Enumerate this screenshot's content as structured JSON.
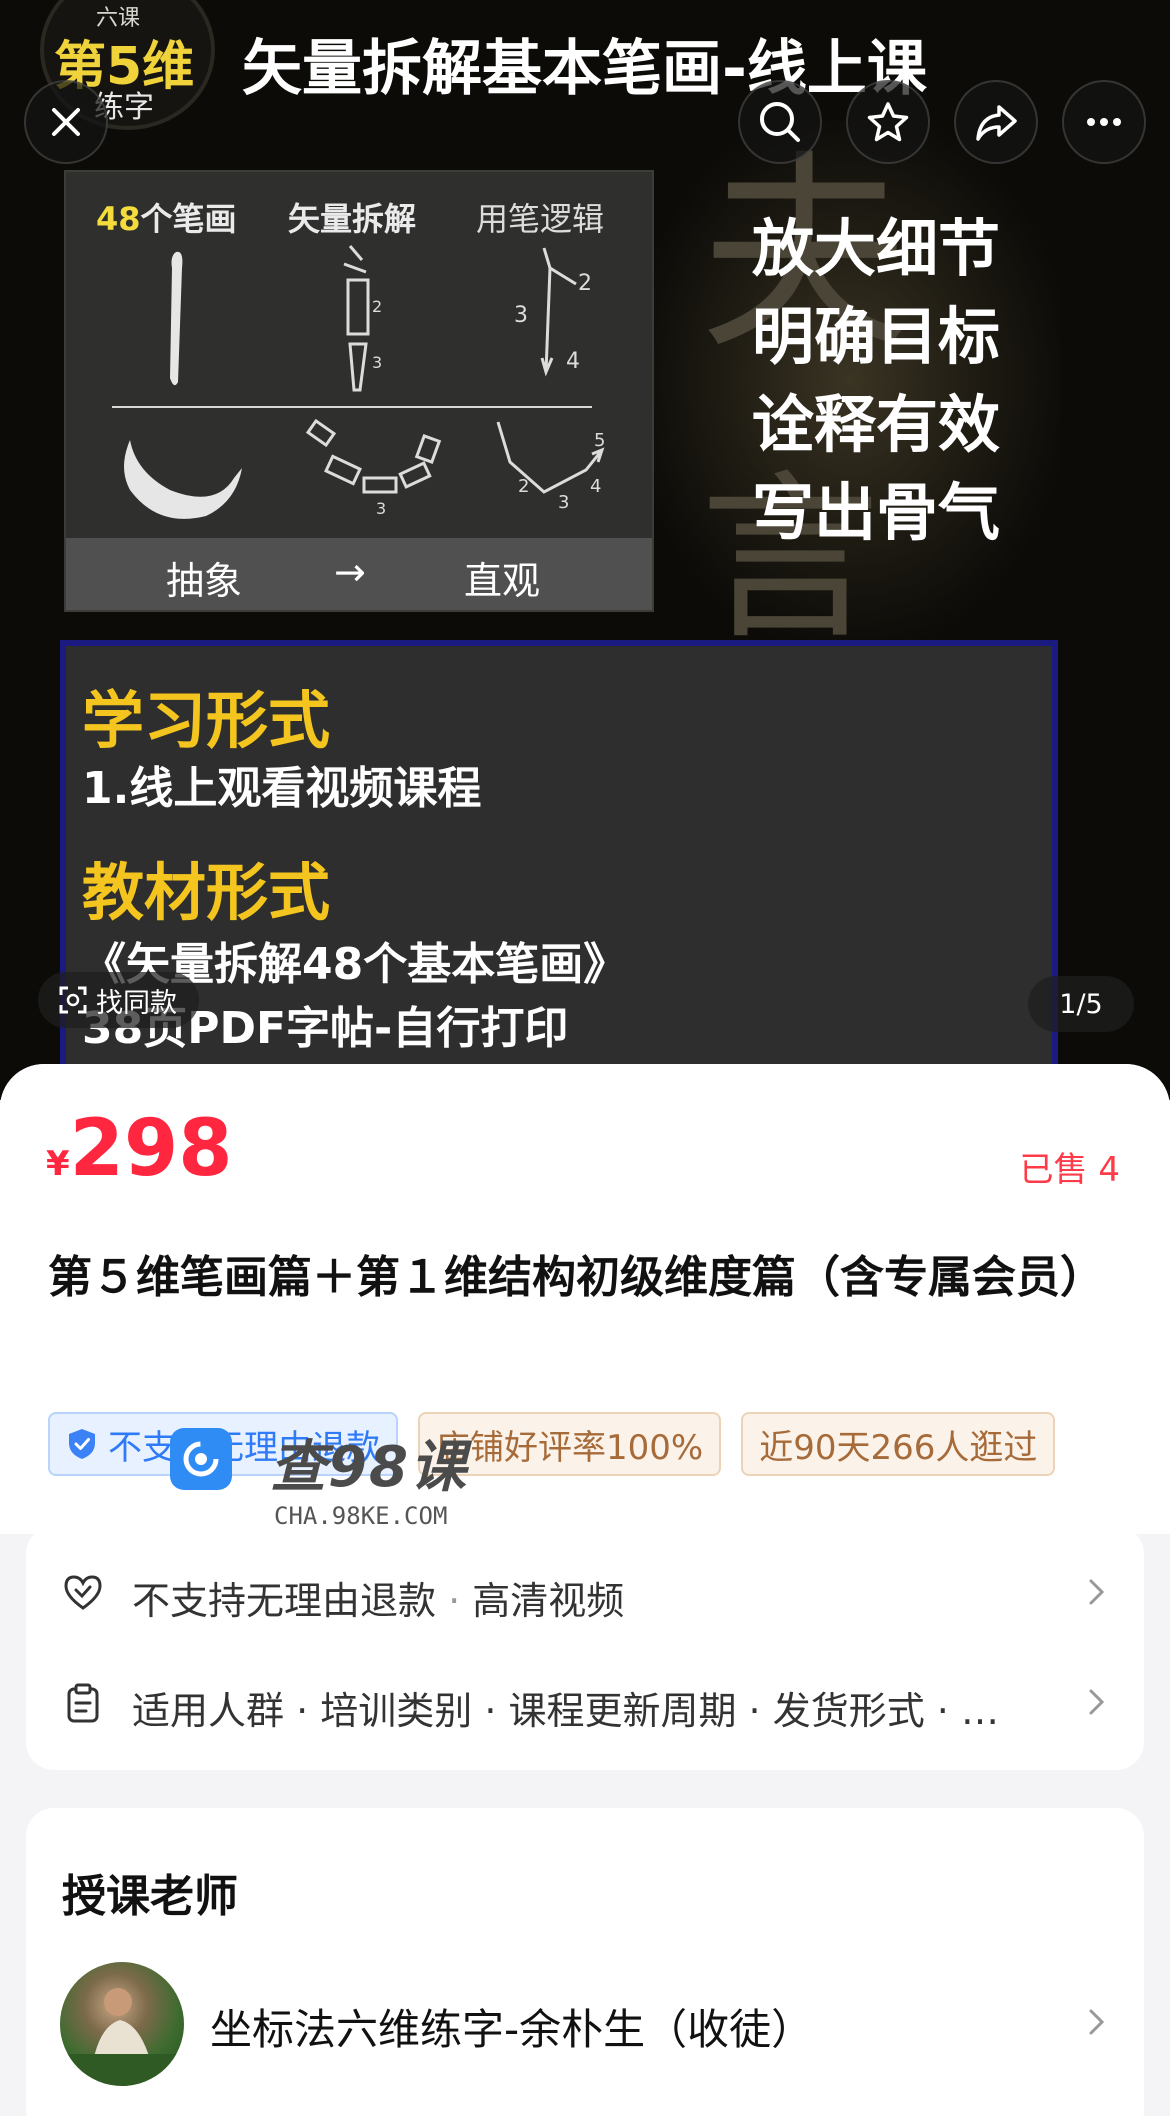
{
  "hero": {
    "badge_top": "六课",
    "badge_main": "第5维",
    "badge_sub": "练字",
    "title": "矢量拆解基本笔画-线上课",
    "stroke_panel": {
      "heading_num": "48",
      "heading_rest": "个笔画",
      "heading_2": "矢量拆解",
      "heading_3": "用笔逻辑",
      "footer_left": "抽象",
      "footer_arrow": "→",
      "footer_right": "直观"
    },
    "promo_lines": [
      "放大细节",
      "明确目标",
      "诠释有效",
      "写出骨气"
    ],
    "learn_panel": {
      "heading_1": "学习形式",
      "text_1": "1.线上观看视频课程",
      "heading_2": "教材形式",
      "text_2": "《矢量拆解48个基本笔画》",
      "text_3": "38页PDF字帖-自行打印"
    },
    "find_same_label": "找同款",
    "page_indicator": "1/5"
  },
  "product": {
    "currency": "¥",
    "price": "298",
    "sold": "已售 4",
    "title": "第５维笔画篇＋第１维结构初级维度篇（含专属会员）",
    "tags": [
      {
        "text": "不支持无理由退款",
        "style": "blue"
      },
      {
        "text": "店铺好评率100%",
        "style": "tan"
      },
      {
        "text": "近90天266人逛过",
        "style": "tan"
      }
    ],
    "watermark": {
      "name": "查98课",
      "url": "CHA.98KE.COM"
    }
  },
  "info": {
    "row1": {
      "a": "不支持无理由退款",
      "sep": " · ",
      "b": "高清视频"
    },
    "row2": {
      "text": "适用人群 · 培训类别 · 课程更新周期 · 发货形式 · …"
    }
  },
  "teacher": {
    "heading": "授课老师",
    "name": "坐标法六维练字-余朴生（收徒）"
  },
  "colors": {
    "price_red": "#ff2740",
    "tag_blue": "#2f7af6",
    "tag_tan": "#a76b3a",
    "promo_yellow": "#f3c51e"
  },
  "icons": [
    "close-icon",
    "search-icon",
    "star-icon",
    "share-icon",
    "more-icon",
    "scan-icon",
    "shield-icon",
    "heart-check-icon",
    "clipboard-icon",
    "chevron-right-icon"
  ]
}
